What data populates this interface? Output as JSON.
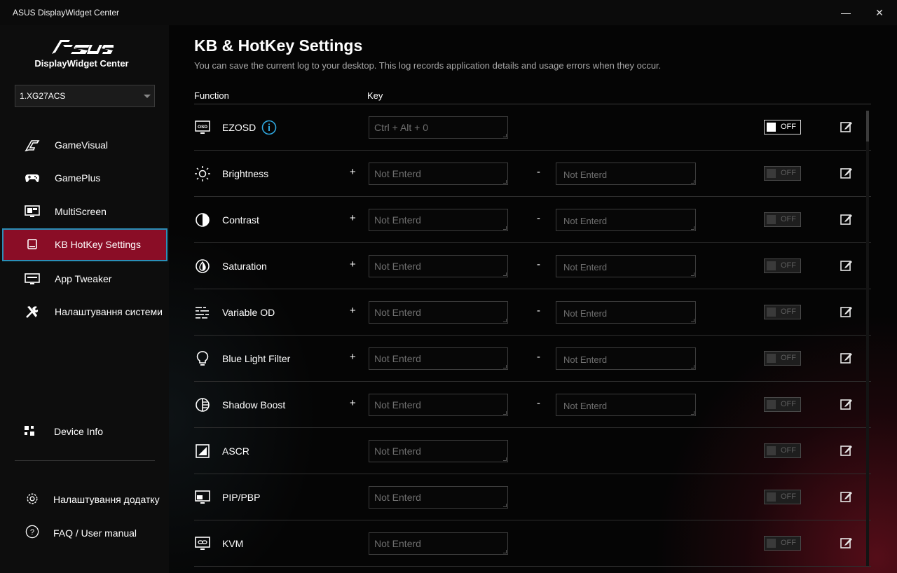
{
  "window": {
    "title": "ASUS DisplayWidget Center",
    "minimize": "—",
    "close": "✕"
  },
  "sidebar": {
    "brand": "DisplayWidget Center",
    "device": "1.XG27ACS",
    "nav": [
      {
        "label": "GameVisual",
        "icon": "gamevisual-icon"
      },
      {
        "label": "GamePlus",
        "icon": "gamepad-icon"
      },
      {
        "label": "MultiScreen",
        "icon": "multiscreen-icon"
      },
      {
        "label": "KB HotKey Settings",
        "icon": "hotkey-icon",
        "active": true
      },
      {
        "label": "App Tweaker",
        "icon": "app-tweaker-icon"
      },
      {
        "label": "Налаштування системи",
        "icon": "tools-icon"
      }
    ],
    "device_info": "Device Info",
    "app_settings": "Налаштування додатку",
    "faq": "FAQ / User manual"
  },
  "main": {
    "title": "KB & HotKey Settings",
    "description": "You can save the current log to your desktop. This log records application details and usage errors when they occur.",
    "col_function": "Function",
    "col_key": "Key",
    "plus_sign": "+",
    "minus_sign": "-",
    "rows": [
      {
        "name": "EZOSD",
        "icon": "osd-icon",
        "key": "Ctrl + Alt + 0",
        "toggle": "OFF"
      },
      {
        "name": "Brightness",
        "icon": "brightness-icon",
        "plus": "Not Enterd",
        "minus": "Not Enterd",
        "toggle": "OFF"
      },
      {
        "name": "Contrast",
        "icon": "contrast-icon",
        "plus": "Not Enterd",
        "minus": "Not Enterd",
        "toggle": "OFF"
      },
      {
        "name": "Saturation",
        "icon": "saturation-icon",
        "plus": "Not Enterd",
        "minus": "Not Enterd",
        "toggle": "OFF"
      },
      {
        "name": "Variable OD",
        "icon": "variable-od-icon",
        "plus": "Not Enterd",
        "minus": "Not Enterd",
        "toggle": "OFF"
      },
      {
        "name": "Blue Light Filter",
        "icon": "bulb-icon",
        "plus": "Not Enterd",
        "minus": "Not Enterd",
        "toggle": "OFF"
      },
      {
        "name": "Shadow Boost",
        "icon": "shadow-boost-icon",
        "plus": "Not Enterd",
        "minus": "Not Enterd",
        "toggle": "OFF"
      },
      {
        "name": "ASCR",
        "icon": "ascr-icon",
        "key": "Not Enterd",
        "toggle": "OFF"
      },
      {
        "name": "PIP/PBP",
        "icon": "pip-icon",
        "key": "Not Enterd",
        "toggle": "OFF"
      },
      {
        "name": "KVM",
        "icon": "kvm-icon",
        "key": "Not Enterd",
        "toggle": "OFF"
      }
    ]
  },
  "colors": {
    "active_nav": "#8a0d26",
    "active_border": "#2a8fb8",
    "info_icon": "#2fa8e0"
  }
}
